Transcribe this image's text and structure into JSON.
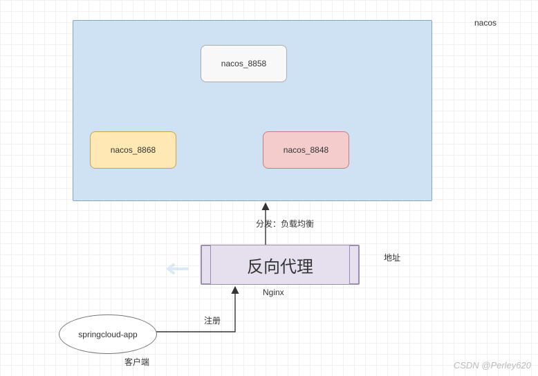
{
  "cluster": {
    "label": "nacos",
    "nodes": {
      "n8858": "nacos_8858",
      "n8868": "nacos_8868",
      "n8848": "nacos_8848"
    }
  },
  "nginx": {
    "title": "反向代理",
    "sublabel": "Nginx"
  },
  "labels": {
    "dispatch": "分发：负载均衡",
    "address": "地址",
    "register": "注册",
    "client": "客户端"
  },
  "app": {
    "name": "springcloud-app"
  },
  "watermark": "CSDN @Perley620"
}
